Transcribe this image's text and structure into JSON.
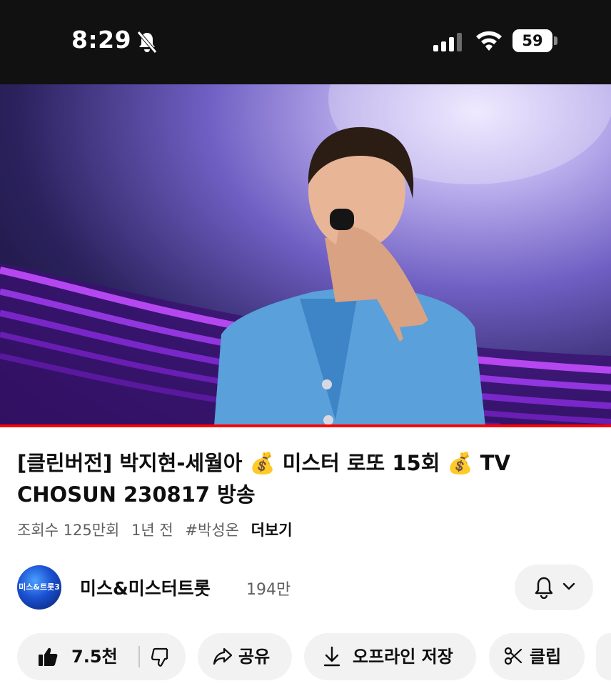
{
  "status_bar": {
    "time": "8:29",
    "battery_level": "59",
    "icons": [
      "mute-icon",
      "signal-icon",
      "wifi-icon",
      "battery-icon"
    ]
  },
  "video": {
    "progress_fraction": 1.0
  },
  "title": {
    "part1": "[클린버전] 박지현-세월아 💰 미스터 로또 15회 💰 TV",
    "part2": "CHOSUN 230817 방송"
  },
  "meta": {
    "views": "조회수 125만회",
    "age": "1년 전",
    "hashtag": "#박성온",
    "more": "더보기"
  },
  "channel": {
    "avatar_text": "미스&트롯3",
    "name": "미스&미스터트롯",
    "subscribers": "194만"
  },
  "actions": {
    "like_count": "7.5천",
    "share": "공유",
    "download": "오프라인 저장",
    "clip": "클립"
  },
  "colors": {
    "accent": "#ff0000",
    "pill_bg": "#f2f2f2",
    "text_primary": "#0f0f0f",
    "text_secondary": "#606060"
  }
}
